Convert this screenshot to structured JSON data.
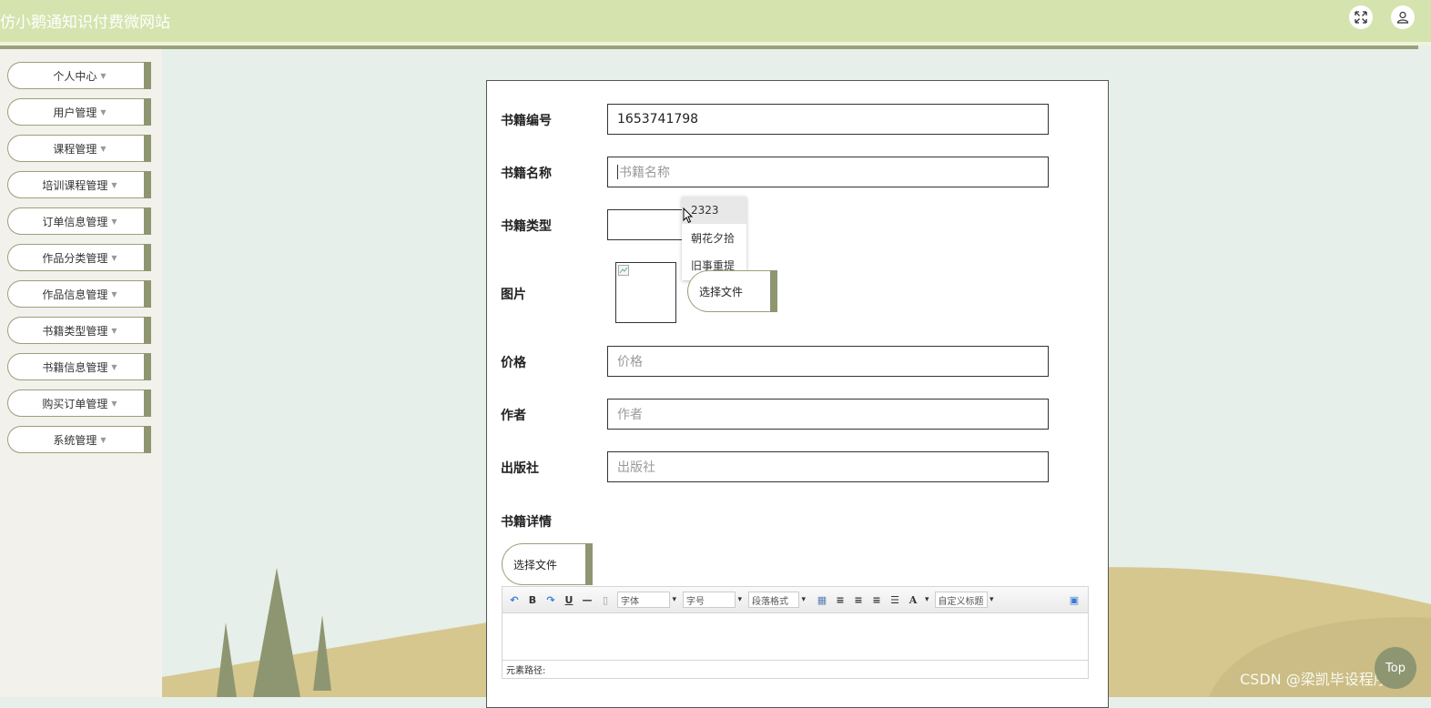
{
  "app": {
    "title": "仿小鹅通知识付费微网站"
  },
  "sidebar": {
    "items": [
      {
        "label": "个人中心"
      },
      {
        "label": "用户管理"
      },
      {
        "label": "课程管理"
      },
      {
        "label": "培训课程管理"
      },
      {
        "label": "订单信息管理"
      },
      {
        "label": "作品分类管理"
      },
      {
        "label": "作品信息管理"
      },
      {
        "label": "书籍类型管理"
      },
      {
        "label": "书籍信息管理"
      },
      {
        "label": "购买订单管理"
      },
      {
        "label": "系统管理"
      }
    ]
  },
  "form": {
    "book_no_label": "书籍编号",
    "book_no_value": "1653741798",
    "book_name_label": "书籍名称",
    "book_name_placeholder": "书籍名称",
    "book_type_label": "书籍类型",
    "book_type_options": [
      "2323",
      "朝花夕拾",
      "旧事重提"
    ],
    "image_label": "图片",
    "choose_file_label": "选择文件",
    "price_label": "价格",
    "price_placeholder": "价格",
    "author_label": "作者",
    "author_placeholder": "作者",
    "publisher_label": "出版社",
    "publisher_placeholder": "出版社",
    "detail_label": "书籍详情",
    "detail_choose_file_label": "选择文件"
  },
  "editor": {
    "font_select": "字体",
    "size_select": "字号",
    "paragraph_select": "段落格式",
    "custom_title_select": "自定义标题",
    "element_path": "元素路径:"
  },
  "watermark": "CSDN @梁凯毕设程序",
  "top_button": "Top",
  "colors": {
    "header": "#d5e3ae",
    "accent": "#8e9671",
    "background": "#e6efe9"
  }
}
